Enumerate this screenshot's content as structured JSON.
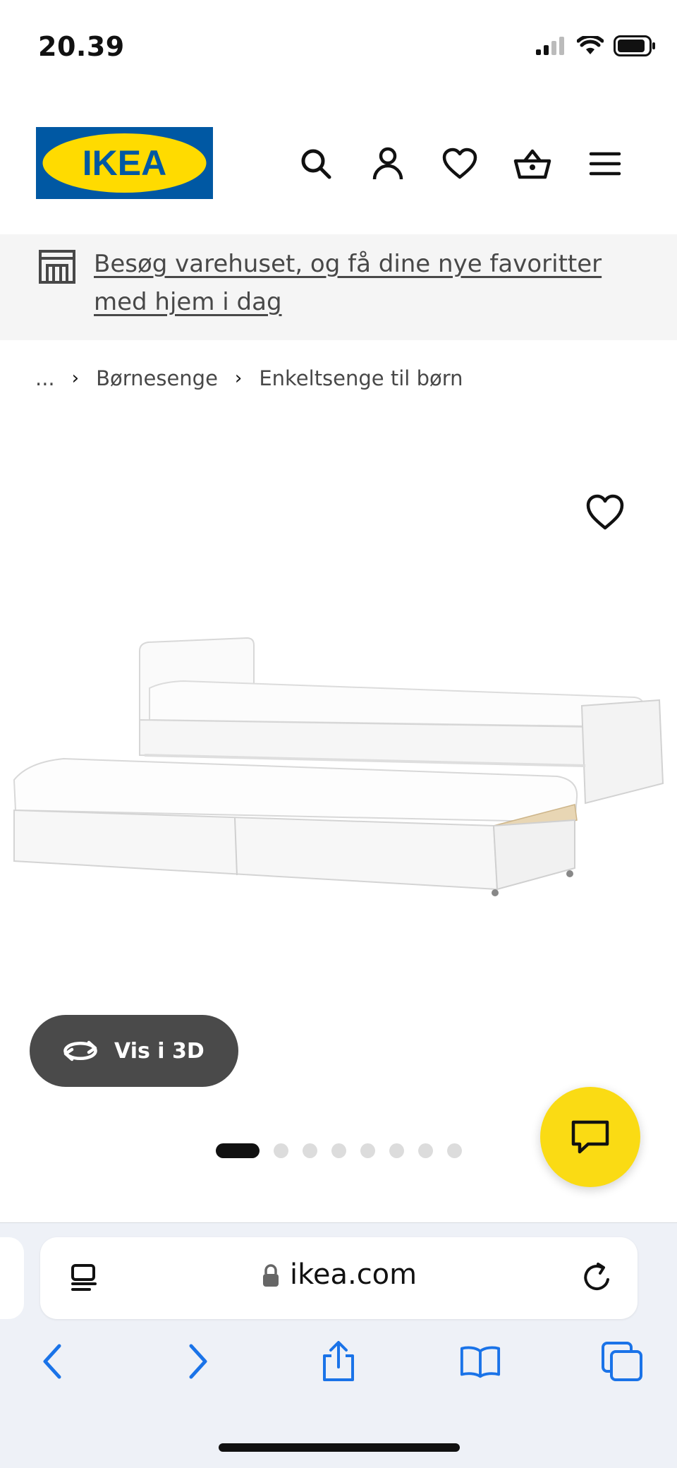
{
  "status_bar": {
    "time": "20.39"
  },
  "header": {
    "logo_text": "IKEA",
    "icons": [
      "search-icon",
      "account-icon",
      "heart-icon",
      "basket-icon",
      "menu-icon"
    ],
    "brand_blue": "#0058A3",
    "brand_yellow": "#FFDB00"
  },
  "banner": {
    "text": "Besøg varehuset, og få dine nye favoritter med hjem i dag"
  },
  "breadcrumb": {
    "items": [
      "...",
      "Børnesenge",
      "Enkeltsenge til børn"
    ]
  },
  "product": {
    "vis3d_label": "Vis i 3D",
    "carousel": {
      "total": 8,
      "active": 1
    }
  },
  "browser": {
    "domain": "ikea.com"
  }
}
